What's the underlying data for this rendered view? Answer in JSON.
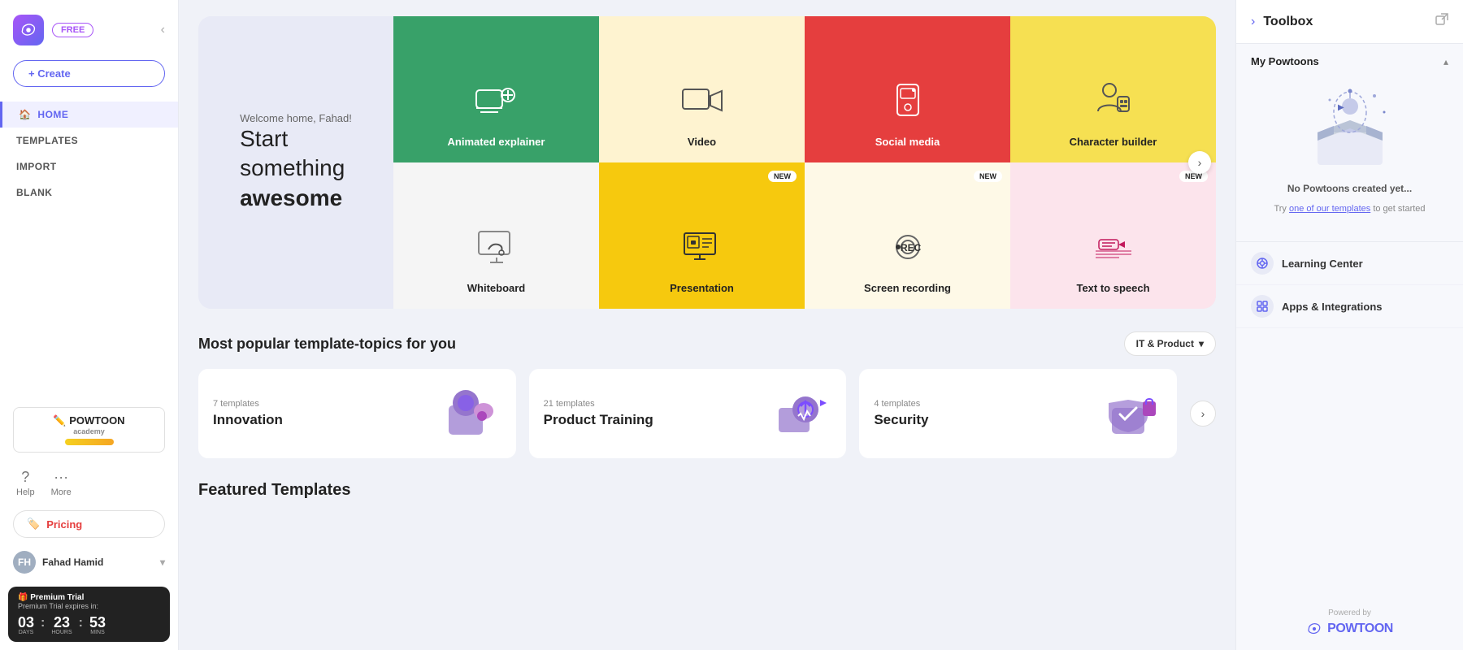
{
  "app": {
    "logo_text": "~",
    "free_badge": "FREE"
  },
  "sidebar": {
    "create_label": "+ Create",
    "nav_items": [
      {
        "id": "home",
        "label": "HOME",
        "active": true
      },
      {
        "id": "templates",
        "label": "TEMPLATES",
        "active": false
      },
      {
        "id": "import",
        "label": "IMPORT",
        "active": false
      },
      {
        "id": "blank",
        "label": "BLANK",
        "active": false
      }
    ],
    "academy_label": "POWTOON academy",
    "help_label": "Help",
    "more_label": "More",
    "pricing_label": "Pricing",
    "user_name": "Fahad Hamid",
    "trial": {
      "title": "Premium Trial expires in:",
      "days": "03",
      "hours": "23",
      "mins": "53",
      "days_label": "DAYS",
      "hours_label": "HOURS",
      "mins_label": "MINS"
    }
  },
  "hero": {
    "welcome": "Welcome home, Fahad!",
    "title_line1": "Start",
    "title_line2": "something",
    "title_strong": "awesome",
    "cards": [
      {
        "id": "animated",
        "label": "Animated explainer",
        "bg": "#38a169",
        "text_color": "light",
        "new": false
      },
      {
        "id": "video",
        "label": "Video",
        "bg": "#fef3d0",
        "text_color": "dark",
        "new": false
      },
      {
        "id": "social",
        "label": "Social media",
        "bg": "#e53e3e",
        "text_color": "light",
        "new": false
      },
      {
        "id": "character",
        "label": "Character builder",
        "bg": "#f6e052",
        "text_color": "dark",
        "new": false
      },
      {
        "id": "whiteboard",
        "label": "Whiteboard",
        "bg": "#f5f5f5",
        "text_color": "dark",
        "new": false
      },
      {
        "id": "presentation",
        "label": "Presentation",
        "bg": "#f6c90e",
        "text_color": "dark",
        "new": true
      },
      {
        "id": "screen",
        "label": "Screen recording",
        "bg": "#fef9e7",
        "text_color": "dark",
        "new": true
      },
      {
        "id": "speech",
        "label": "Text to speech",
        "bg": "#fce4ec",
        "text_color": "dark",
        "new": true
      }
    ]
  },
  "popular": {
    "section_title": "Most popular template-topics for you",
    "dropdown_label": "IT & Product",
    "templates": [
      {
        "id": "innovation",
        "count": "7 templates",
        "name": "Innovation",
        "emoji": "💡"
      },
      {
        "id": "product_training",
        "count": "21 templates",
        "name": "Product Training",
        "emoji": "⚙️"
      },
      {
        "id": "security",
        "count": "4 templates",
        "name": "Security",
        "emoji": "🛡️"
      }
    ]
  },
  "featured": {
    "title": "Featured Templates"
  },
  "toolbox": {
    "title": "Toolbox",
    "collapse_label": "›",
    "sections": {
      "my_powtoons": {
        "label": "My Powtoons",
        "no_powtoons_text": "No Powtoons created yet...",
        "sub_text_prefix": "Try ",
        "sub_text_link": "one of our templates",
        "sub_text_suffix": " to get started"
      }
    },
    "items": [
      {
        "id": "learning_center",
        "label": "Learning Center"
      },
      {
        "id": "apps_integrations",
        "label": "Apps & Integrations"
      }
    ],
    "powered_by": "Powered by",
    "brand": "POWTOON"
  }
}
